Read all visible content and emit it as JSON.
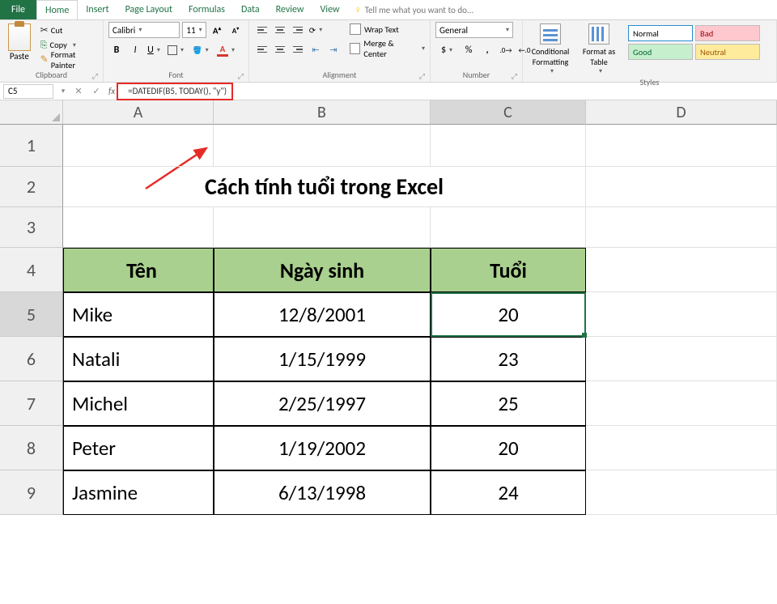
{
  "tabs": {
    "file": "File",
    "home": "Home",
    "insert": "Insert",
    "page_layout": "Page Layout",
    "formulas": "Formulas",
    "data": "Data",
    "review": "Review",
    "view": "View",
    "tell_me": "Tell me what you want to do..."
  },
  "clipboard": {
    "paste": "Paste",
    "cut": "Cut",
    "copy": "Copy",
    "painter": "Format Painter",
    "group": "Clipboard"
  },
  "font": {
    "name": "Calibri",
    "size": "11",
    "group": "Font"
  },
  "alignment": {
    "wrap": "Wrap Text",
    "merge": "Merge & Center",
    "group": "Alignment"
  },
  "number": {
    "format": "General",
    "group": "Number"
  },
  "styles": {
    "conditional": "Conditional Formatting",
    "format_table": "Format as Table",
    "normal": "Normal",
    "bad": "Bad",
    "good": "Good",
    "neutral": "Neutral",
    "group": "Styles"
  },
  "namebox": "C5",
  "formula": "=DATEDIF(B5, TODAY(), \"y\")",
  "columns": {
    "A": "A",
    "B": "B",
    "C": "C",
    "D": "D"
  },
  "rows": {
    "1": "1",
    "2": "2",
    "3": "3",
    "4": "4",
    "5": "5",
    "6": "6",
    "7": "7",
    "8": "8",
    "9": "9"
  },
  "title": "Cách tính tuổi trong Excel",
  "headers": {
    "name": "Tên",
    "dob": "Ngày sinh",
    "age": "Tuổi"
  },
  "people": [
    {
      "name": "Mike",
      "dob": "12/8/2001",
      "age": "20"
    },
    {
      "name": "Natali",
      "dob": "1/15/1999",
      "age": "23"
    },
    {
      "name": "Michel",
      "dob": "2/25/1997",
      "age": "25"
    },
    {
      "name": "Peter",
      "dob": "1/19/2002",
      "age": "20"
    },
    {
      "name": "Jasmine",
      "dob": "6/13/1998",
      "age": "24"
    }
  ]
}
